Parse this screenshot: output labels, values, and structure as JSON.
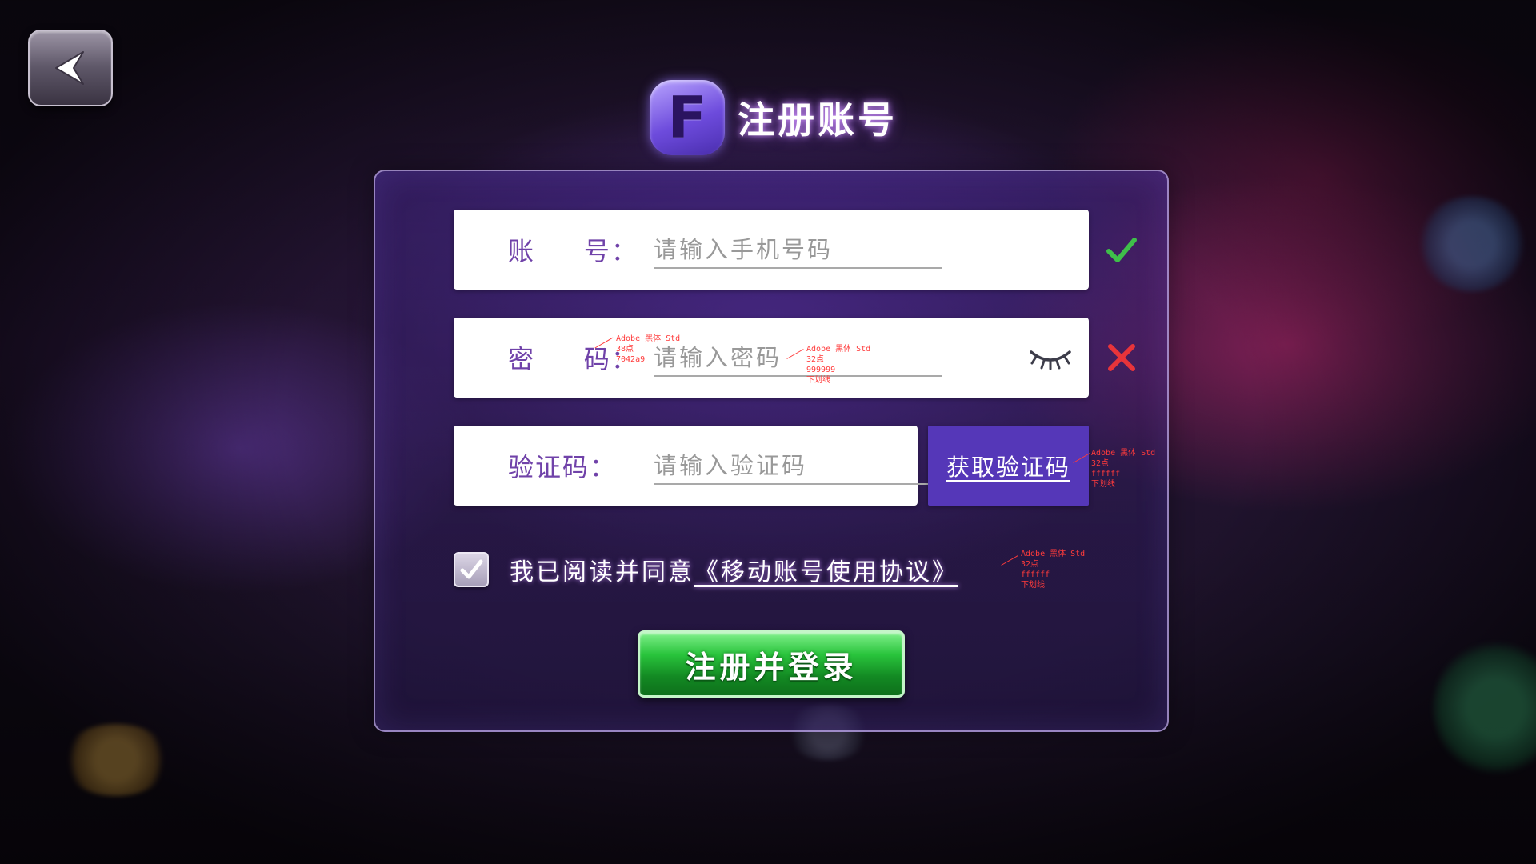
{
  "header": {
    "logo_letter": "F",
    "title": "注册账号"
  },
  "form": {
    "account": {
      "label": "账     号：",
      "placeholder": "请输入手机号码",
      "status": "valid"
    },
    "password": {
      "label": "密     码：",
      "placeholder": "请输入密码",
      "status": "invalid"
    },
    "code": {
      "label": "验证码：",
      "placeholder": "请输入验证码"
    },
    "get_code_label": "获取验证码",
    "agreement": {
      "checked": true,
      "text": "我已阅读并同意",
      "link": "《移动账号使用协议》"
    },
    "submit_label": "注册并登录"
  },
  "annotations": {
    "label_spec": "Adobe 黑体 Std\n38点\n7042a9",
    "placeholder_spec": "Adobe 黑体 Std\n32点\n999999\n下划线",
    "code_button_spec": "Adobe 黑体 Std\n32点\nffffff\n下划线",
    "agreement_spec": "Adobe 黑体 Std\n32点\nffffff\n下划线"
  },
  "colors": {
    "label": "#7042a9",
    "placeholder": "#999999",
    "accent": "#5537b8",
    "valid": "#3fbf4a",
    "invalid": "#e8343a",
    "submit": "#1fa532"
  },
  "icons": {
    "back": "back-arrow-icon",
    "valid": "checkmark-icon",
    "invalid": "cross-icon",
    "password_toggle": "eye-closed-icon",
    "agreement": "checkbox-check-icon"
  }
}
